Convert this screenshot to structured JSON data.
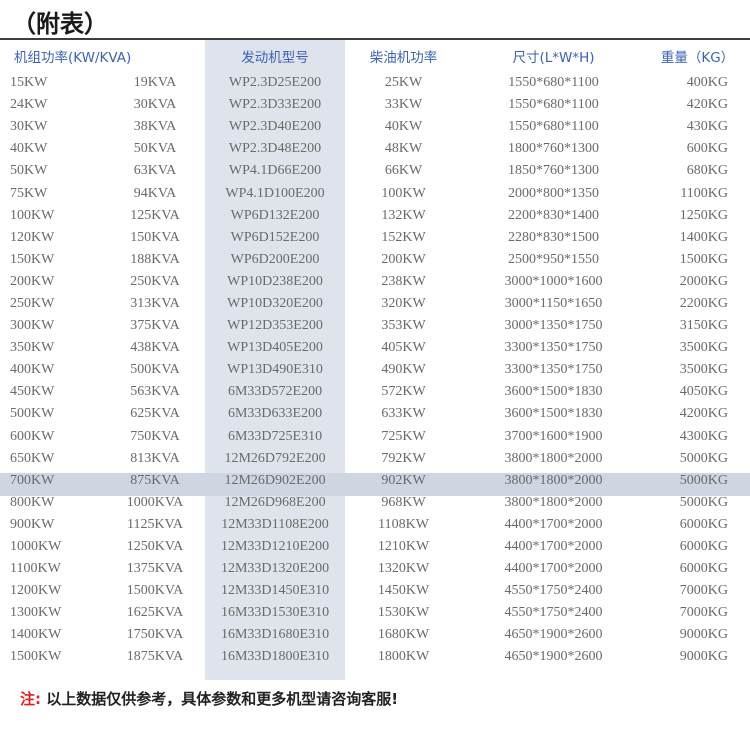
{
  "title": "（附表）",
  "headers": {
    "unit_power": "机组功率(KW/KVA)",
    "engine_model": "发动机型号",
    "diesel_power": "柴油机功率",
    "size": "尺寸(L*W*H)",
    "weight": "重量（KG）"
  },
  "rows": [
    [
      "15KW",
      "19KVA",
      "WP2.3D25E200",
      "25KW",
      "1550*680*1100",
      "400KG"
    ],
    [
      "24KW",
      "30KVA",
      "WP2.3D33E200",
      "33KW",
      "1550*680*1100",
      "420KG"
    ],
    [
      "30KW",
      "38KVA",
      "WP2.3D40E200",
      "40KW",
      "1550*680*1100",
      "430KG"
    ],
    [
      "40KW",
      "50KVA",
      "WP2.3D48E200",
      "48KW",
      "1800*760*1300",
      "600KG"
    ],
    [
      "50KW",
      "63KVA",
      "WP4.1D66E200",
      "66KW",
      "1850*760*1300",
      "680KG"
    ],
    [
      "75KW",
      "94KVA",
      "WP4.1D100E200",
      "100KW",
      "2000*800*1350",
      "1100KG"
    ],
    [
      "100KW",
      "125KVA",
      "WP6D132E200",
      "132KW",
      "2200*830*1400",
      "1250KG"
    ],
    [
      "120KW",
      "150KVA",
      "WP6D152E200",
      "152KW",
      "2280*830*1500",
      "1400KG"
    ],
    [
      "150KW",
      "188KVA",
      "WP6D200E200",
      "200KW",
      "2500*950*1550",
      "1500KG"
    ],
    [
      "200KW",
      "250KVA",
      "WP10D238E200",
      "238KW",
      "3000*1000*1600",
      "2000KG"
    ],
    [
      "250KW",
      "313KVA",
      "WP10D320E200",
      "320KW",
      "3000*1150*1650",
      "2200KG"
    ],
    [
      "300KW",
      "375KVA",
      "WP12D353E200",
      "353KW",
      "3000*1350*1750",
      "3150KG"
    ],
    [
      "350KW",
      "438KVA",
      "WP13D405E200",
      "405KW",
      "3300*1350*1750",
      "3500KG"
    ],
    [
      "400KW",
      "500KVA",
      "WP13D490E310",
      "490KW",
      "3300*1350*1750",
      "3500KG"
    ],
    [
      "450KW",
      "563KVA",
      "6M33D572E200",
      "572KW",
      "3600*1500*1830",
      "4050KG"
    ],
    [
      "500KW",
      "625KVA",
      "6M33D633E200",
      "633KW",
      "3600*1500*1830",
      "4200KG"
    ],
    [
      "600KW",
      "750KVA",
      "6M33D725E310",
      "725KW",
      "3700*1600*1900",
      "4300KG"
    ],
    [
      "650KW",
      "813KVA",
      "12M26D792E200",
      "792KW",
      "3800*1800*2000",
      "5000KG"
    ],
    [
      "700KW",
      "875KVA",
      "12M26D902E200",
      "902KW",
      "3800*1800*2000",
      "5000KG"
    ],
    [
      "800KW",
      "1000KVA",
      "12M26D968E200",
      "968KW",
      "3800*1800*2000",
      "5000KG"
    ],
    [
      "900KW",
      "1125KVA",
      "12M33D1108E200",
      "1108KW",
      "4400*1700*2000",
      "6000KG"
    ],
    [
      "1000KW",
      "1250KVA",
      "12M33D1210E200",
      "1210KW",
      "4400*1700*2000",
      "6000KG"
    ],
    [
      "1100KW",
      "1375KVA",
      "12M33D1320E200",
      "1320KW",
      "4400*1700*2000",
      "6000KG"
    ],
    [
      "1200KW",
      "1500KVA",
      "12M33D1450E310",
      "1450KW",
      "4550*1750*2400",
      "7000KG"
    ],
    [
      "1300KW",
      "1625KVA",
      "16M33D1530E310",
      "1530KW",
      "4550*1750*2400",
      "7000KG"
    ],
    [
      "1400KW",
      "1750KVA",
      "16M33D1680E310",
      "1680KW",
      "4650*1900*2600",
      "9000KG"
    ],
    [
      "1500KW",
      "1875KVA",
      "16M33D1800E310",
      "1800KW",
      "4650*1900*2600",
      "9000KG"
    ]
  ],
  "highlighted_row_index": 18,
  "note": {
    "lead": "注:",
    "text": "以上数据仅供参考，具体参数和更多机型请咨询客服!"
  },
  "colors": {
    "header_text": "#3a63b8",
    "model_column_bg": "#dfe4ec",
    "highlight_row_bg": "#cfd6e1",
    "note_lead": "#e0211d"
  }
}
